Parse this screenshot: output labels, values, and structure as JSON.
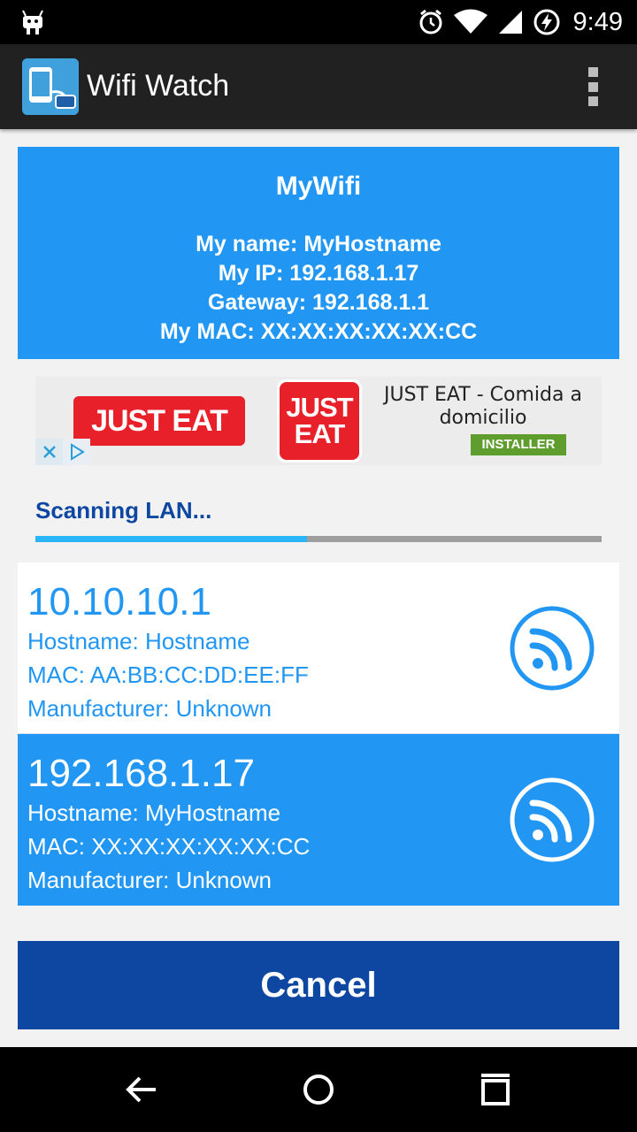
{
  "status_bar": {
    "time": "9:49",
    "icons": [
      "android-debug-icon",
      "alarm-icon",
      "wifi-signal-icon",
      "cell-signal-icon",
      "battery-charging-icon"
    ]
  },
  "action_bar": {
    "title": "Wifi Watch",
    "menu_icon": "overflow-menu-icon"
  },
  "network": {
    "ssid": "MyWifi",
    "name_line": "My name: MyHostname",
    "ip_line": "My IP: 192.168.1.17",
    "gateway_line": "Gateway: 192.168.1.1",
    "mac_line": "My MAC: XX:XX:XX:XX:XX:CC"
  },
  "ad": {
    "logo_text": "JUST EAT",
    "logo_square_line1": "JUST",
    "logo_square_line2": "EAT",
    "title": "JUST EAT - Comida a domicilio",
    "install_label": "INSTALLER"
  },
  "scan": {
    "label": "Scanning LAN...",
    "progress": 0.48
  },
  "devices": [
    {
      "ip": "10.10.10.1",
      "hostname": "Hostname: Hostname",
      "mac": "MAC: AA:BB:CC:DD:EE:FF",
      "manufacturer": "Manufacturer: Unknown",
      "selected": false
    },
    {
      "ip": "192.168.1.17",
      "hostname": "Hostname: MyHostname",
      "mac": "MAC: XX:XX:XX:XX:XX:CC",
      "manufacturer": "Manufacturer: Unknown",
      "selected": true
    }
  ],
  "cancel_label": "Cancel",
  "colors": {
    "accent": "#2196f3",
    "dark_blue": "#0d47a1",
    "ad_red": "#e8202a",
    "install_green": "#5f9e2e"
  },
  "nav": [
    "back-icon",
    "home-icon",
    "recents-icon"
  ]
}
